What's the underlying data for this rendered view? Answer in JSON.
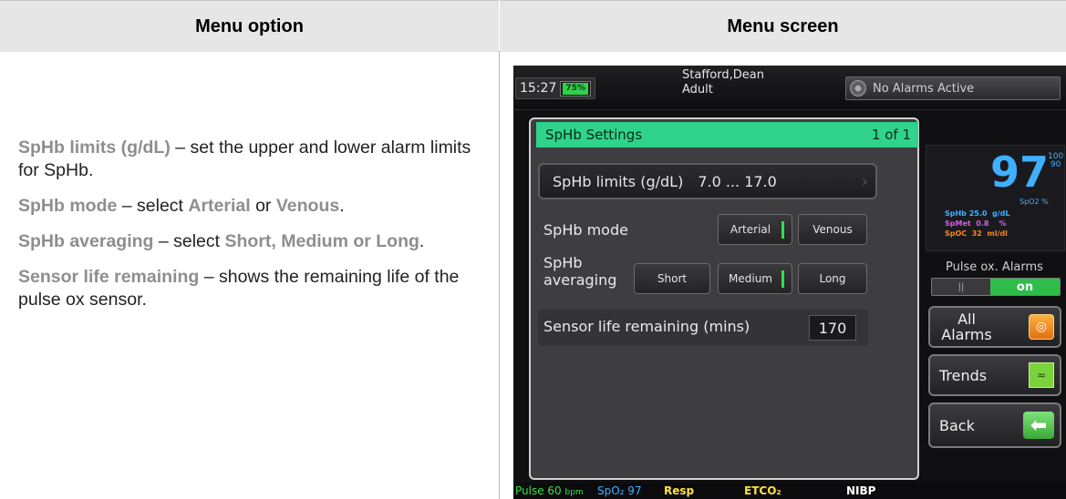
{
  "table": {
    "header_left": "Menu option",
    "header_right": "Menu screen"
  },
  "descriptions": [
    {
      "term": "SpHb limits (g/dL)",
      "text": " – set the upper and lower alarm limits for SpHb."
    },
    {
      "term": "SpHb mode",
      "text_pre": " – select ",
      "opt1": "Arterial",
      "mid": " or ",
      "opt2": "Venous",
      "end": "."
    },
    {
      "term": "SpHb averaging",
      "text_pre": " – select ",
      "opts": "Short, Medium or Long",
      "end": "."
    },
    {
      "term": "Sensor life remaining",
      "text": " – shows the remaining life of the pulse ox sensor."
    }
  ],
  "device": {
    "time": "15:27",
    "battery": "75%",
    "patient_name": "Stafford,Dean",
    "patient_type": "Adult",
    "alarm_status": "No Alarms Active",
    "panel_title": "SpHb Settings",
    "panel_page": "1 of 1",
    "limits_label": "SpHb limits (g/dL)",
    "limits_value": "7.0 ... 17.0",
    "mode_label": "SpHb mode",
    "mode_arterial": "Arterial",
    "mode_venous": "Venous",
    "averaging_label": "SpHb averaging",
    "avg_short": "Short",
    "avg_medium": "Medium",
    "avg_long": "Long",
    "sensor_label": "Sensor life remaining (mins)",
    "sensor_value": "170",
    "spo2_value": "97",
    "spo2_high": "100",
    "spo2_low": "90",
    "spo2_label": "SpO2 %",
    "sphb_line": "SpHb 25.0  g/dL",
    "spmet_line": "SpMet  0.8    %",
    "spoc_line": "SpOC  32  ml/dl",
    "pulse_alarms_label": "Pulse ox. Alarms",
    "toggle_off": "||",
    "toggle_on": "on",
    "all_alarms_label": "All Alarms",
    "trends_label": "Trends",
    "back_label": "Back",
    "bottom_pulse": "Pulse 60",
    "bottom_pulse_unit": "bpm",
    "bottom_spo2": "SpO₂ 97",
    "bottom_resp": "Resp",
    "bottom_etco2": "ETCO₂",
    "bottom_nibp": "NIBP"
  }
}
